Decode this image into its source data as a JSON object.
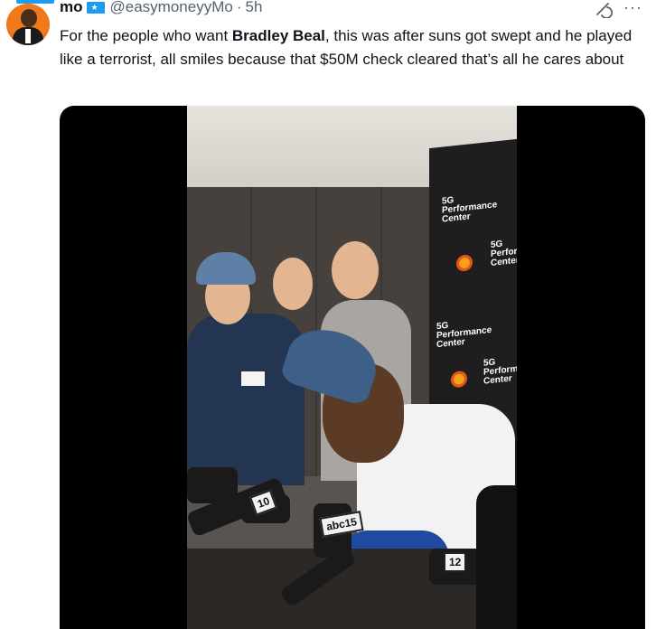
{
  "tweet": {
    "display_name": "mo",
    "verified_badge_icon": "flag-badge-icon",
    "handle": "@easymoneyyMo",
    "separator": "·",
    "time": "5h",
    "text_before": "For the people who want ",
    "text_bold": "Bradley Beal",
    "text_after": ", this was after suns got swept and he played like a terrorist, all smiles because that $50M check cleared that’s all he cares about",
    "more_label": "···"
  },
  "media": {
    "type": "video",
    "backdrop_logo_lines": [
      "5G",
      "Performance",
      "Center"
    ],
    "mic_flags": [
      "abc15",
      "12",
      "10"
    ]
  },
  "colors": {
    "accent": "#1d9bf0",
    "text_primary": "#0f1419",
    "text_secondary": "#536471",
    "media_background": "#000000"
  }
}
